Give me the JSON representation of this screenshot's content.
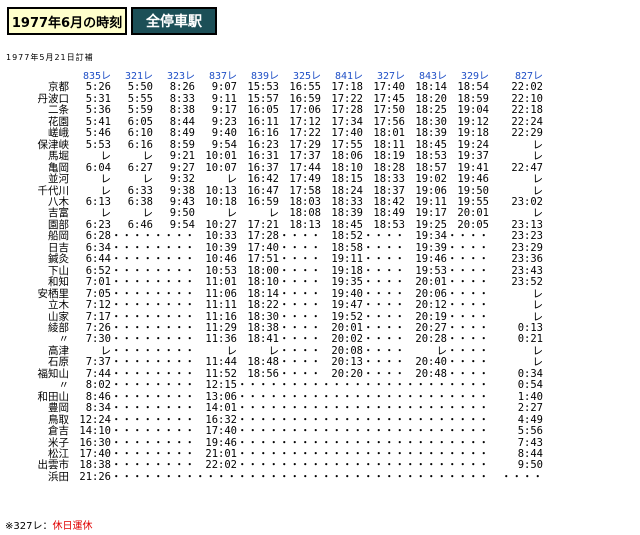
{
  "header": {
    "title": "1977年6月の時刻",
    "mode": "全停車駅"
  },
  "revision_note": "1977年5月21日訂補",
  "trains": [
    "835レ",
    "321レ",
    "323レ",
    "837レ",
    "839レ",
    "325レ",
    "841レ",
    "327レ",
    "843レ",
    "329レ",
    "827レ"
  ],
  "rows": [
    {
      "station": "京都",
      "times": [
        "5:26",
        "5:50",
        "8:26",
        "9:07",
        "15:53",
        "16:55",
        "17:18",
        "17:40",
        "18:14",
        "18:54",
        "22:02"
      ]
    },
    {
      "station": "丹波口",
      "times": [
        "5:31",
        "5:55",
        "8:33",
        "9:11",
        "15:57",
        "16:59",
        "17:22",
        "17:45",
        "18:20",
        "18:59",
        "22:10"
      ]
    },
    {
      "station": "二条",
      "times": [
        "5:36",
        "5:59",
        "8:38",
        "9:17",
        "16:05",
        "17:06",
        "17:28",
        "17:50",
        "18:25",
        "19:04",
        "22:18"
      ]
    },
    {
      "station": "花園",
      "times": [
        "5:41",
        "6:05",
        "8:44",
        "9:23",
        "16:11",
        "17:12",
        "17:34",
        "17:56",
        "18:30",
        "19:12",
        "22:24"
      ]
    },
    {
      "station": "嵯峨",
      "times": [
        "5:46",
        "6:10",
        "8:49",
        "9:40",
        "16:16",
        "17:22",
        "17:40",
        "18:01",
        "18:39",
        "19:18",
        "22:29"
      ]
    },
    {
      "station": "保津峡",
      "times": [
        "5:53",
        "6:16",
        "8:59",
        "9:54",
        "16:23",
        "17:29",
        "17:55",
        "18:11",
        "18:45",
        "19:24",
        "レ"
      ]
    },
    {
      "station": "馬堀",
      "times": [
        "レ",
        "レ",
        "9:21",
        "10:01",
        "16:31",
        "17:37",
        "18:06",
        "18:19",
        "18:53",
        "19:37",
        "レ"
      ]
    },
    {
      "station": "亀岡",
      "times": [
        "6:04",
        "6:27",
        "9:27",
        "10:07",
        "16:37",
        "17:44",
        "18:10",
        "18:28",
        "18:57",
        "19:41",
        "22:47"
      ]
    },
    {
      "station": "並河",
      "times": [
        "レ",
        "レ",
        "9:32",
        "レ",
        "16:42",
        "17:49",
        "18:15",
        "18:33",
        "19:02",
        "19:46",
        "レ"
      ]
    },
    {
      "station": "千代川",
      "times": [
        "レ",
        "6:33",
        "9:38",
        "10:13",
        "16:47",
        "17:58",
        "18:24",
        "18:37",
        "19:06",
        "19:50",
        "レ"
      ]
    },
    {
      "station": "八木",
      "times": [
        "6:13",
        "6:38",
        "9:43",
        "10:18",
        "16:59",
        "18:03",
        "18:33",
        "18:42",
        "19:11",
        "19:55",
        "23:02"
      ]
    },
    {
      "station": "吉富",
      "times": [
        "レ",
        "レ",
        "9:50",
        "レ",
        "レ",
        "18:08",
        "18:39",
        "18:49",
        "19:17",
        "20:01",
        "レ"
      ]
    },
    {
      "station": "園部",
      "times": [
        "6:23",
        "6:46",
        "9:54",
        "10:27",
        "17:21",
        "18:13",
        "18:45",
        "18:53",
        "19:25",
        "20:05",
        "23:13"
      ]
    },
    {
      "station": "船岡",
      "times": [
        "6:28",
        "・・・・",
        "・・・・",
        "10:33",
        "17:28",
        "・・・・",
        "18:52",
        "・・・・",
        "19:34",
        "・・・・",
        "23:23"
      ]
    },
    {
      "station": "日吉",
      "times": [
        "6:34",
        "・・・・",
        "・・・・",
        "10:39",
        "17:40",
        "・・・・",
        "18:58",
        "・・・・",
        "19:39",
        "・・・・",
        "23:29"
      ]
    },
    {
      "station": "鍼灸",
      "times": [
        "6:44",
        "・・・・",
        "・・・・",
        "10:46",
        "17:51",
        "・・・・",
        "19:11",
        "・・・・",
        "19:46",
        "・・・・",
        "23:36"
      ]
    },
    {
      "station": "下山",
      "times": [
        "6:52",
        "・・・・",
        "・・・・",
        "10:53",
        "18:00",
        "・・・・",
        "19:18",
        "・・・・",
        "19:53",
        "・・・・",
        "23:43"
      ]
    },
    {
      "station": "和知",
      "times": [
        "7:01",
        "・・・・",
        "・・・・",
        "11:01",
        "18:10",
        "・・・・",
        "19:35",
        "・・・・",
        "20:01",
        "・・・・",
        "23:52"
      ]
    },
    {
      "station": "安栖里",
      "times": [
        "7:05",
        "・・・・",
        "・・・・",
        "11:06",
        "18:14",
        "・・・・",
        "19:40",
        "・・・・",
        "20:06",
        "・・・・",
        "レ"
      ]
    },
    {
      "station": "立木",
      "times": [
        "7:12",
        "・・・・",
        "・・・・",
        "11:11",
        "18:22",
        "・・・・",
        "19:47",
        "・・・・",
        "20:12",
        "・・・・",
        "レ"
      ]
    },
    {
      "station": "山家",
      "times": [
        "7:17",
        "・・・・",
        "・・・・",
        "11:16",
        "18:30",
        "・・・・",
        "19:52",
        "・・・・",
        "20:19",
        "・・・・",
        "レ"
      ]
    },
    {
      "station": "綾部",
      "times": [
        "7:26",
        "・・・・",
        "・・・・",
        "11:29",
        "18:38",
        "・・・・",
        "20:01",
        "・・・・",
        "20:27",
        "・・・・",
        "0:13"
      ]
    },
    {
      "station": "〃",
      "times": [
        "7:30",
        "・・・・",
        "・・・・",
        "11:36",
        "18:41",
        "・・・・",
        "20:02",
        "・・・・",
        "20:28",
        "・・・・",
        "0:21"
      ]
    },
    {
      "station": "高津",
      "times": [
        "レ",
        "・・・・",
        "・・・・",
        "レ",
        "レ",
        "・・・・",
        "20:08",
        "・・・・",
        "レ",
        "・・・・",
        "レ"
      ]
    },
    {
      "station": "石原",
      "times": [
        "7:37",
        "・・・・",
        "・・・・",
        "11:44",
        "18:48",
        "・・・・",
        "20:13",
        "・・・・",
        "20:40",
        "・・・・",
        "レ"
      ]
    },
    {
      "station": "福知山",
      "times": [
        "7:44",
        "・・・・",
        "・・・・",
        "11:52",
        "18:56",
        "・・・・",
        "20:20",
        "・・・・",
        "20:48",
        "・・・・",
        "0:34"
      ]
    },
    {
      "station": "〃",
      "times": [
        "8:02",
        "・・・・",
        "・・・・",
        "12:15",
        "・・・・",
        "・・・・",
        "・・・・",
        "・・・・",
        "・・・・",
        "・・・・",
        "0:54"
      ]
    },
    {
      "station": "和田山",
      "times": [
        "8:46",
        "・・・・",
        "・・・・",
        "13:06",
        "・・・・",
        "・・・・",
        "・・・・",
        "・・・・",
        "・・・・",
        "・・・・",
        "1:40"
      ]
    },
    {
      "station": "豊岡",
      "times": [
        "8:34",
        "・・・・",
        "・・・・",
        "14:01",
        "・・・・",
        "・・・・",
        "・・・・",
        "・・・・",
        "・・・・",
        "・・・・",
        "2:27"
      ]
    },
    {
      "station": "鳥取",
      "times": [
        "12:24",
        "・・・・",
        "・・・・",
        "16:32",
        "・・・・",
        "・・・・",
        "・・・・",
        "・・・・",
        "・・・・",
        "・・・・",
        "4:49"
      ]
    },
    {
      "station": "倉吉",
      "times": [
        "14:10",
        "・・・・",
        "・・・・",
        "17:40",
        "・・・・",
        "・・・・",
        "・・・・",
        "・・・・",
        "・・・・",
        "・・・・",
        "5:56"
      ]
    },
    {
      "station": "米子",
      "times": [
        "16:30",
        "・・・・",
        "・・・・",
        "19:46",
        "・・・・",
        "・・・・",
        "・・・・",
        "・・・・",
        "・・・・",
        "・・・・",
        "7:43"
      ]
    },
    {
      "station": "松江",
      "times": [
        "17:40",
        "・・・・",
        "・・・・",
        "21:01",
        "・・・・",
        "・・・・",
        "・・・・",
        "・・・・",
        "・・・・",
        "・・・・",
        "8:44"
      ]
    },
    {
      "station": "出雲市",
      "times": [
        "18:38",
        "・・・・",
        "・・・・",
        "22:02",
        "・・・・",
        "・・・・",
        "・・・・",
        "・・・・",
        "・・・・",
        "・・・・",
        "9:50"
      ]
    },
    {
      "station": "浜田",
      "times": [
        "21:26",
        "・・・・",
        "・・・・",
        "・・・・",
        "・・・・",
        "・・・・",
        "・・・・",
        "・・・・",
        "・・・・",
        "・・・・",
        "・・・・"
      ]
    }
  ],
  "footnote": {
    "prefix": "※327レ：",
    "text": "休日運休",
    "text_color": "#e00000"
  },
  "colors": {
    "title_bg": "#ffffcc",
    "mode_bg": "#1c4f57",
    "train_header": "#1f4fc6"
  }
}
